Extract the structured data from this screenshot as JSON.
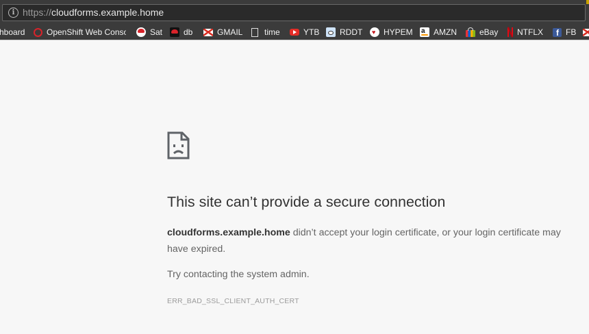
{
  "address_bar": {
    "scheme": "https://",
    "host": "cloudforms.example.home"
  },
  "bookmarks": [
    {
      "label": "hboard",
      "icon": "none"
    },
    {
      "label": "OpenShift Web Conso",
      "icon": "openshift-icon"
    },
    {
      "label": "Sat",
      "icon": "redhat-icon"
    },
    {
      "label": "db",
      "icon": "redhat-dark-icon"
    },
    {
      "label": "GMAIL",
      "icon": "gmail-icon"
    },
    {
      "label": "time",
      "icon": "page-icon"
    },
    {
      "label": "YTB",
      "icon": "youtube-icon"
    },
    {
      "label": "RDDT",
      "icon": "reddit-icon"
    },
    {
      "label": "HYPEM",
      "icon": "hypem-icon"
    },
    {
      "label": "AMZN",
      "icon": "amazon-icon"
    },
    {
      "label": "eBay",
      "icon": "ebay-icon"
    },
    {
      "label": "NTFLX",
      "icon": "netflix-icon"
    },
    {
      "label": "FB",
      "icon": "facebook-icon"
    },
    {
      "label": "",
      "icon": "gmail-icon"
    }
  ],
  "error": {
    "title": "This site can’t provide a secure connection",
    "host_bold": "cloudforms.example.home",
    "message_rest": " didn’t accept your login certificate, or your login certificate may have expired.",
    "hint": "Try contacting the system admin.",
    "code": "ERR_BAD_SSL_CLIENT_AUTH_CERT"
  },
  "colors": {
    "chrome_dark": "#3b3b3b",
    "page_bg": "#f7f7f7",
    "title_text": "#333333",
    "body_text": "#646464",
    "code_text": "#9b9b9b"
  }
}
